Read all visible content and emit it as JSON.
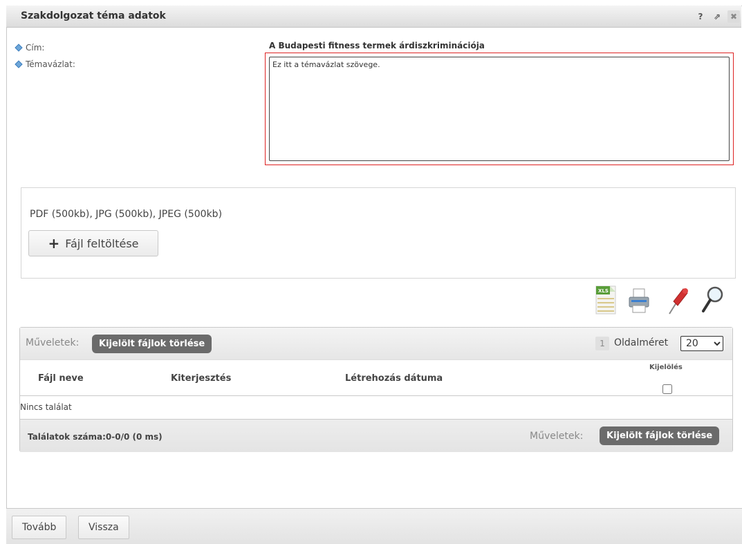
{
  "window": {
    "title": "Szakdolgozat téma adatok",
    "help_label": "?",
    "popout_label": "⇗",
    "close_label": "✖"
  },
  "form": {
    "title_label": "Cím:",
    "title_value": "A Budapesti fitness termek árdiszkriminációja",
    "outline_label": "Témavázlat:",
    "outline_value": "Ez itt a témavázlat szövege."
  },
  "upload": {
    "allowed_types": "PDF (500kb), JPG (500kb), JPEG (500kb)",
    "button_label": "Fájl feltöltése"
  },
  "toolbar": {
    "icons": [
      "excel-export-icon",
      "print-icon",
      "pin-icon",
      "search-icon"
    ]
  },
  "grid": {
    "ops_label": "Műveletek:",
    "delete_selected_label": "Kijelölt fájlok törlése",
    "page_number": "1",
    "page_size_label": "Oldalméret",
    "page_size_value": "20",
    "columns": [
      "Fájl neve",
      "Kiterjesztés",
      "Létrehozás dátuma"
    ],
    "select_column": "Kijelölés",
    "empty_text": "Nincs találat",
    "result_count": "Találatok száma:0-0/0 (0 ms)",
    "footer_ops_label": "Műveletek:",
    "footer_delete_label": "Kijelölt fájlok törlése"
  },
  "footer": {
    "next_label": "Tovább",
    "back_label": "Vissza"
  }
}
